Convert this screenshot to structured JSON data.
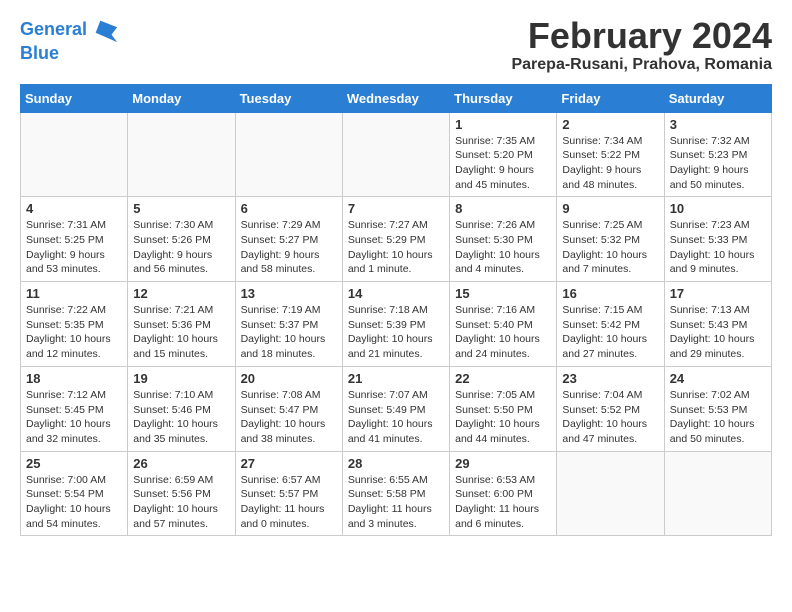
{
  "header": {
    "logo_line1": "General",
    "logo_line2": "Blue",
    "title": "February 2024",
    "subtitle": "Parepa-Rusani, Prahova, Romania"
  },
  "columns": [
    "Sunday",
    "Monday",
    "Tuesday",
    "Wednesday",
    "Thursday",
    "Friday",
    "Saturday"
  ],
  "weeks": [
    [
      {
        "day": "",
        "info": ""
      },
      {
        "day": "",
        "info": ""
      },
      {
        "day": "",
        "info": ""
      },
      {
        "day": "",
        "info": ""
      },
      {
        "day": "1",
        "info": "Sunrise: 7:35 AM\nSunset: 5:20 PM\nDaylight: 9 hours\nand 45 minutes."
      },
      {
        "day": "2",
        "info": "Sunrise: 7:34 AM\nSunset: 5:22 PM\nDaylight: 9 hours\nand 48 minutes."
      },
      {
        "day": "3",
        "info": "Sunrise: 7:32 AM\nSunset: 5:23 PM\nDaylight: 9 hours\nand 50 minutes."
      }
    ],
    [
      {
        "day": "4",
        "info": "Sunrise: 7:31 AM\nSunset: 5:25 PM\nDaylight: 9 hours\nand 53 minutes."
      },
      {
        "day": "5",
        "info": "Sunrise: 7:30 AM\nSunset: 5:26 PM\nDaylight: 9 hours\nand 56 minutes."
      },
      {
        "day": "6",
        "info": "Sunrise: 7:29 AM\nSunset: 5:27 PM\nDaylight: 9 hours\nand 58 minutes."
      },
      {
        "day": "7",
        "info": "Sunrise: 7:27 AM\nSunset: 5:29 PM\nDaylight: 10 hours\nand 1 minute."
      },
      {
        "day": "8",
        "info": "Sunrise: 7:26 AM\nSunset: 5:30 PM\nDaylight: 10 hours\nand 4 minutes."
      },
      {
        "day": "9",
        "info": "Sunrise: 7:25 AM\nSunset: 5:32 PM\nDaylight: 10 hours\nand 7 minutes."
      },
      {
        "day": "10",
        "info": "Sunrise: 7:23 AM\nSunset: 5:33 PM\nDaylight: 10 hours\nand 9 minutes."
      }
    ],
    [
      {
        "day": "11",
        "info": "Sunrise: 7:22 AM\nSunset: 5:35 PM\nDaylight: 10 hours\nand 12 minutes."
      },
      {
        "day": "12",
        "info": "Sunrise: 7:21 AM\nSunset: 5:36 PM\nDaylight: 10 hours\nand 15 minutes."
      },
      {
        "day": "13",
        "info": "Sunrise: 7:19 AM\nSunset: 5:37 PM\nDaylight: 10 hours\nand 18 minutes."
      },
      {
        "day": "14",
        "info": "Sunrise: 7:18 AM\nSunset: 5:39 PM\nDaylight: 10 hours\nand 21 minutes."
      },
      {
        "day": "15",
        "info": "Sunrise: 7:16 AM\nSunset: 5:40 PM\nDaylight: 10 hours\nand 24 minutes."
      },
      {
        "day": "16",
        "info": "Sunrise: 7:15 AM\nSunset: 5:42 PM\nDaylight: 10 hours\nand 27 minutes."
      },
      {
        "day": "17",
        "info": "Sunrise: 7:13 AM\nSunset: 5:43 PM\nDaylight: 10 hours\nand 29 minutes."
      }
    ],
    [
      {
        "day": "18",
        "info": "Sunrise: 7:12 AM\nSunset: 5:45 PM\nDaylight: 10 hours\nand 32 minutes."
      },
      {
        "day": "19",
        "info": "Sunrise: 7:10 AM\nSunset: 5:46 PM\nDaylight: 10 hours\nand 35 minutes."
      },
      {
        "day": "20",
        "info": "Sunrise: 7:08 AM\nSunset: 5:47 PM\nDaylight: 10 hours\nand 38 minutes."
      },
      {
        "day": "21",
        "info": "Sunrise: 7:07 AM\nSunset: 5:49 PM\nDaylight: 10 hours\nand 41 minutes."
      },
      {
        "day": "22",
        "info": "Sunrise: 7:05 AM\nSunset: 5:50 PM\nDaylight: 10 hours\nand 44 minutes."
      },
      {
        "day": "23",
        "info": "Sunrise: 7:04 AM\nSunset: 5:52 PM\nDaylight: 10 hours\nand 47 minutes."
      },
      {
        "day": "24",
        "info": "Sunrise: 7:02 AM\nSunset: 5:53 PM\nDaylight: 10 hours\nand 50 minutes."
      }
    ],
    [
      {
        "day": "25",
        "info": "Sunrise: 7:00 AM\nSunset: 5:54 PM\nDaylight: 10 hours\nand 54 minutes."
      },
      {
        "day": "26",
        "info": "Sunrise: 6:59 AM\nSunset: 5:56 PM\nDaylight: 10 hours\nand 57 minutes."
      },
      {
        "day": "27",
        "info": "Sunrise: 6:57 AM\nSunset: 5:57 PM\nDaylight: 11 hours\nand 0 minutes."
      },
      {
        "day": "28",
        "info": "Sunrise: 6:55 AM\nSunset: 5:58 PM\nDaylight: 11 hours\nand 3 minutes."
      },
      {
        "day": "29",
        "info": "Sunrise: 6:53 AM\nSunset: 6:00 PM\nDaylight: 11 hours\nand 6 minutes."
      },
      {
        "day": "",
        "info": ""
      },
      {
        "day": "",
        "info": ""
      }
    ]
  ]
}
